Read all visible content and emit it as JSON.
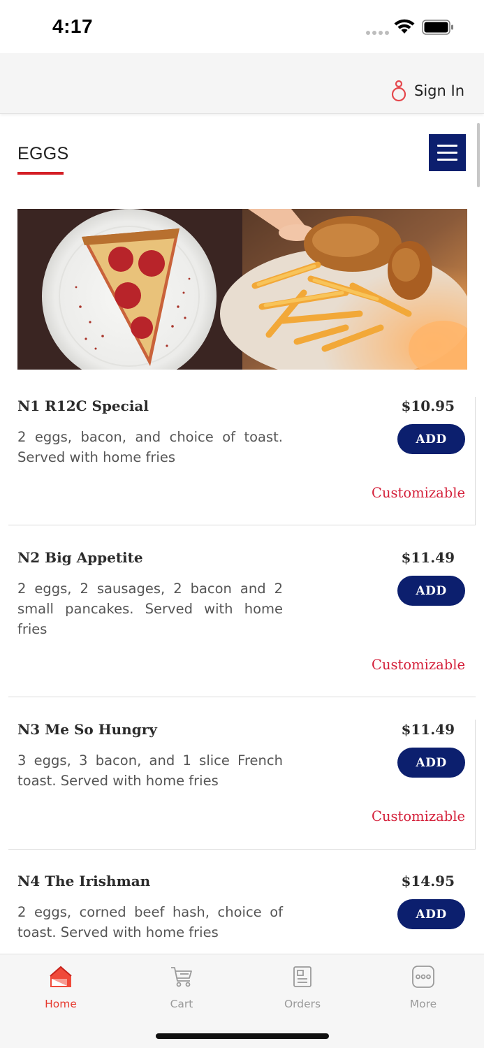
{
  "status_bar": {
    "time": "4:17"
  },
  "header": {
    "sign_in_label": "Sign In",
    "accent_color": "#e5484d"
  },
  "category": {
    "title": "EGGS",
    "accent_color": "#d41f26"
  },
  "banner": {
    "images": [
      "pizza-slice-image",
      "fried-chicken-fries-image"
    ]
  },
  "items": [
    {
      "name": "N1 R12C Special",
      "description": "2 eggs, bacon, and choice of toast. Served with home fries",
      "price": "$10.95",
      "add_label": "ADD",
      "customizable_label": "Customizable"
    },
    {
      "name": "N2 Big Appetite",
      "description": "2 eggs, 2 sausages, 2 bacon and 2 small pancakes. Served with home fries",
      "price": "$11.49",
      "add_label": "ADD",
      "customizable_label": "Customizable"
    },
    {
      "name": "N3 Me So Hungry",
      "description": "3 eggs, 3 bacon, and 1 slice French toast. Served with home fries",
      "price": "$11.49",
      "add_label": "ADD",
      "customizable_label": "Customizable"
    },
    {
      "name": "N4 The Irishman",
      "description": "2 eggs, corned beef hash, choice of toast. Served with home fries",
      "price": "$14.95",
      "add_label": "ADD"
    }
  ],
  "bottom_nav": {
    "items": [
      {
        "label": "Home",
        "icon": "home-icon",
        "active": true
      },
      {
        "label": "Cart",
        "icon": "cart-icon",
        "active": false
      },
      {
        "label": "Orders",
        "icon": "orders-icon",
        "active": false
      },
      {
        "label": "More",
        "icon": "more-icon",
        "active": false
      }
    ],
    "active_color": "#e63a2e"
  },
  "colors": {
    "primary": "#0c1f6e",
    "customizable": "#d4203a"
  }
}
